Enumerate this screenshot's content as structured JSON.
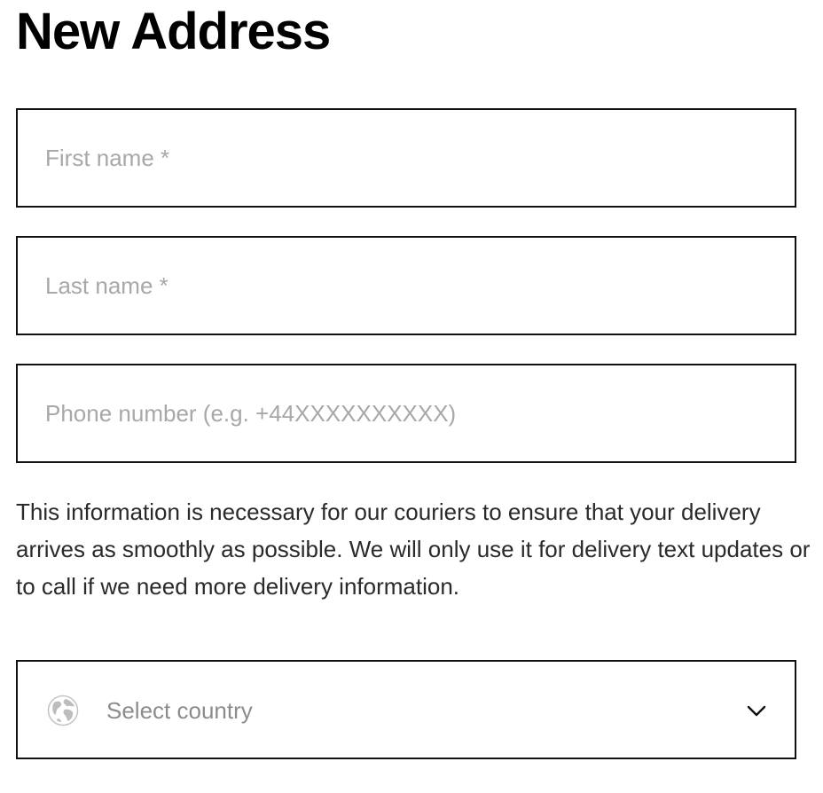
{
  "page": {
    "title": "New Address"
  },
  "form": {
    "first_name": {
      "value": "",
      "placeholder": "First name *"
    },
    "last_name": {
      "value": "",
      "placeholder": "Last name *"
    },
    "phone": {
      "value": "",
      "placeholder": "Phone number (e.g. +44XXXXXXXXXX)"
    },
    "phone_helper": "This information is necessary for our couriers to ensure that your delivery arrives as smoothly as possible. We will only use it for delivery text updates or to call if we need more delivery information.",
    "country": {
      "placeholder": "Select country",
      "icon": "globe-icon",
      "dropdown_icon": "chevron-down-icon"
    }
  },
  "colors": {
    "border": "#111111",
    "placeholder": "#a8a8a8",
    "text": "#2a2a2a"
  }
}
